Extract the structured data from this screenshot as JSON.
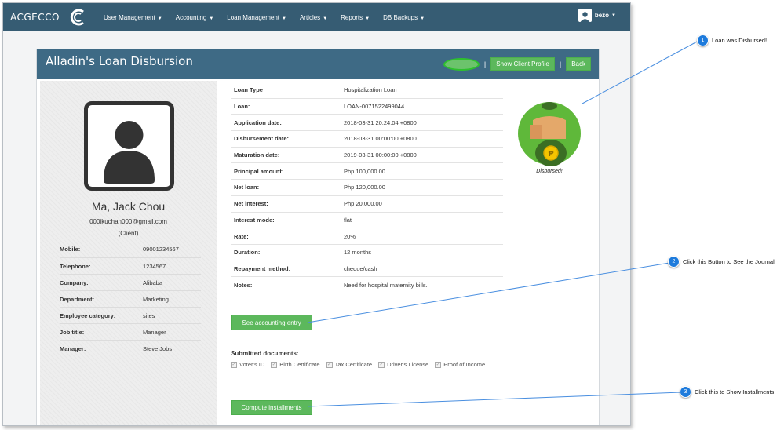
{
  "navbar": {
    "brand": "ACGECCO",
    "menu": [
      {
        "label": "User Management"
      },
      {
        "label": "Accounting"
      },
      {
        "label": "Loan Management"
      },
      {
        "label": "Articles"
      },
      {
        "label": "Reports"
      },
      {
        "label": "DB Backups"
      }
    ],
    "user": "bezo"
  },
  "page": {
    "title": "Alladin's Loan Disbursion",
    "buttons": {
      "show_client_profile": "Show Client Profile",
      "back": "Back",
      "separator": "|"
    }
  },
  "client": {
    "name": "Ma, Jack Chou",
    "email": "000ikuchan000@gmail.com",
    "role": "(Client)",
    "info": [
      {
        "label": "Mobile:",
        "value": "09001234567"
      },
      {
        "label": "Telephone:",
        "value": "1234567"
      },
      {
        "label": "Company:",
        "value": "Alibaba"
      },
      {
        "label": "Department:",
        "value": "Marketing"
      },
      {
        "label": "Employee category:",
        "value": "sites"
      },
      {
        "label": "Job title:",
        "value": "Manager"
      },
      {
        "label": "Manager:",
        "value": "Steve Jobs"
      }
    ]
  },
  "loan": {
    "rows": [
      {
        "label": "Loan Type",
        "value": "Hospitalization Loan"
      },
      {
        "label": "Loan:",
        "value": "LOAN-0071522499044"
      },
      {
        "label": "Application date:",
        "value": "2018-03-31 20:24:04 +0800"
      },
      {
        "label": "Disbursement date:",
        "value": "2018-03-31 00:00:00 +0800"
      },
      {
        "label": "Maturation date:",
        "value": "2019-03-31 00:00:00 +0800"
      },
      {
        "label": "Principal amount:",
        "value": "Php 100,000.00"
      },
      {
        "label": "Net loan:",
        "value": "Php 120,000.00"
      },
      {
        "label": "Net interest:",
        "value": "Php 20,000.00"
      },
      {
        "label": "Interest mode:",
        "value": "flat"
      },
      {
        "label": "Rate:",
        "value": "20%"
      },
      {
        "label": "Duration:",
        "value": "12 months"
      },
      {
        "label": "Repayment method:",
        "value": "cheque/cash"
      },
      {
        "label": "Notes:",
        "value": "Need for hospital maternity bills."
      }
    ],
    "status_label": "Disbursed!",
    "coin_symbol": "₱"
  },
  "actions": {
    "accounting_entry": "See accounting entry",
    "compute_installments": "Compute installments"
  },
  "documents": {
    "title": "Submitted documents:",
    "items": [
      {
        "label": "Voter's ID",
        "checked": true
      },
      {
        "label": "Birth Certificate",
        "checked": true
      },
      {
        "label": "Tax Certificate",
        "checked": true
      },
      {
        "label": "Driver's License",
        "checked": true
      },
      {
        "label": "Proof of Income",
        "checked": true
      }
    ]
  },
  "callouts": [
    {
      "num": "1",
      "text": "Loan was Disbursed!"
    },
    {
      "num": "2",
      "text": "Click this Button to See the Journal"
    },
    {
      "num": "3",
      "text": "Click this to Show Installments"
    }
  ],
  "colors": {
    "navbar": "#365c73",
    "panel_header": "#3e6a85",
    "button_green": "#5cb85c",
    "callout_blue": "#1e7bdc",
    "coin_gold": "#f5c400",
    "bag_green": "#3b6e24"
  }
}
